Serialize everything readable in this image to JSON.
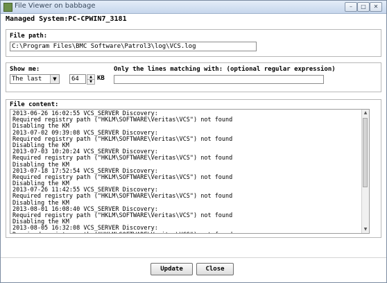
{
  "window": {
    "title": "File Viewer on babbage",
    "minimize_glyph": "–",
    "maximize_glyph": "□",
    "close_glyph": "✕",
    "icon": "app-icon"
  },
  "managed_system": "Managed System:PC-CPWIN7_3181",
  "file_path": {
    "label": "File path:",
    "value": "C:\\Program Files\\BMC Software\\Patrol3\\log\\VCS.log"
  },
  "filter": {
    "show_me_label": "Show me:",
    "show_me_value": "The last",
    "size_value": "64",
    "size_unit": "KB",
    "regex_label": "Only the lines matching with: (optional regular expression)",
    "regex_value": ""
  },
  "file_content": {
    "label": "File content:",
    "lines": [
      "2013-06-26 16:02:55 VCS_SERVER Discovery:",
      "Required registry path (\"HKLM\\SOFTWARE\\Veritas\\VCS\") not found",
      "Disabling the KM",
      "2013-07-02 09:39:08 VCS_SERVER Discovery:",
      "Required registry path (\"HKLM\\SOFTWARE\\Veritas\\VCS\") not found",
      "Disabling the KM",
      "2013-07-03 10:20:24 VCS_SERVER Discovery:",
      "Required registry path (\"HKLM\\SOFTWARE\\Veritas\\VCS\") not found",
      "Disabling the KM",
      "2013-07-18 17:52:54 VCS_SERVER Discovery:",
      "Required registry path (\"HKLM\\SOFTWARE\\Veritas\\VCS\") not found",
      "Disabling the KM",
      "2013-07-26 11:42:55 VCS_SERVER Discovery:",
      "Required registry path (\"HKLM\\SOFTWARE\\Veritas\\VCS\") not found",
      "Disabling the KM",
      "2013-08-01 16:08:40 VCS_SERVER Discovery:",
      "Required registry path (\"HKLM\\SOFTWARE\\Veritas\\VCS\") not found",
      "Disabling the KM",
      "2013-08-05 16:32:08 VCS_SERVER Discovery:",
      "Required registry path (\"HKLM\\SOFTWARE\\Veritas\\VCS\") not found"
    ]
  },
  "buttons": {
    "update": "Update",
    "close": "Close"
  }
}
